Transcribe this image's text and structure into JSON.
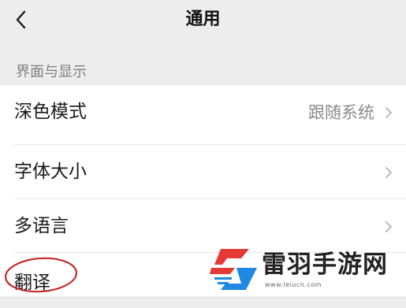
{
  "header": {
    "title": "通用",
    "back_icon": "chevron-left-icon"
  },
  "section": {
    "title": "界面与显示"
  },
  "items": [
    {
      "label": "深色模式",
      "value": "跟随系统",
      "icon": "chevron-right-icon"
    },
    {
      "label": "字体大小",
      "icon": "chevron-right-icon"
    },
    {
      "label": "多语言",
      "icon": "chevron-right-icon"
    },
    {
      "label": "翻译",
      "annotation": "red-circle-highlight"
    }
  ],
  "watermark": {
    "name": "雷羽手游网",
    "url": "www.leiucn.com",
    "logo_colors": [
      "#e53935",
      "#1e88e5"
    ]
  },
  "colors": {
    "background": "#ededed",
    "list_bg": "#ffffff",
    "annotation": "#c62828"
  }
}
